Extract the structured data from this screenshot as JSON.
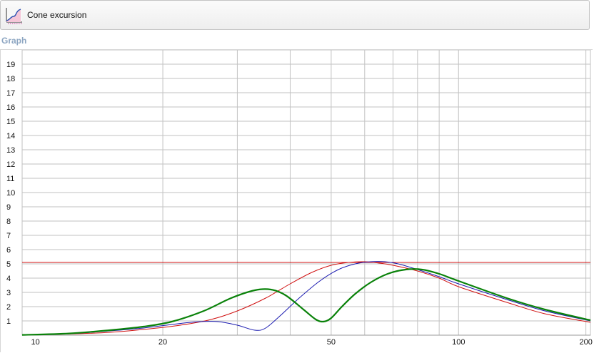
{
  "toolbar": {
    "button_label": "Cone excursion",
    "button_icon": "graph-icon"
  },
  "section": {
    "title": "Graph"
  },
  "colors": {
    "grid": "#c2c2c2",
    "axis_text": "#111111",
    "red": "#d01010",
    "blue": "#1a1ab0",
    "green": "#0a820a",
    "limit": "#d01010"
  },
  "chart_data": {
    "type": "line",
    "x_scale": "log",
    "xlim": [
      9.3,
      205
    ],
    "ylim": [
      0,
      20
    ],
    "x_ticks": [
      10,
      20,
      50,
      100,
      200
    ],
    "x_tick_labels": [
      "10",
      "20",
      "50",
      "100",
      "200"
    ],
    "x_gridlines": [
      20,
      30,
      40,
      50,
      60,
      70,
      80,
      90,
      100,
      200
    ],
    "y_ticks": [
      1,
      2,
      3,
      4,
      5,
      6,
      7,
      8,
      9,
      10,
      11,
      12,
      13,
      14,
      15,
      16,
      17,
      18,
      19
    ],
    "y_tick_labels": [
      "1",
      "2",
      "3",
      "4",
      "5",
      "6",
      "7",
      "8",
      "9",
      "10",
      "11",
      "12",
      "13",
      "14",
      "15",
      "16",
      "17",
      "18",
      "19"
    ],
    "grid": true,
    "limit_line": {
      "y": 5.1,
      "color": "red"
    },
    "series": [
      {
        "color": "red",
        "x": [
          9.3,
          12,
          15,
          18,
          22,
          26,
          30,
          35,
          40,
          45,
          50,
          55,
          60,
          65,
          70,
          80,
          90,
          100,
          130,
          160,
          205
        ],
        "y": [
          0.02,
          0.08,
          0.2,
          0.4,
          0.7,
          1.1,
          1.7,
          2.6,
          3.6,
          4.4,
          4.9,
          5.1,
          5.15,
          5.05,
          4.9,
          4.5,
          4.0,
          3.4,
          2.3,
          1.5,
          0.9
        ]
      },
      {
        "color": "blue",
        "x": [
          9.3,
          12,
          15,
          18,
          21,
          24,
          27,
          30,
          33,
          35,
          38,
          42,
          47,
          52,
          57,
          62,
          67,
          72,
          80,
          90,
          100,
          130,
          160,
          205
        ],
        "y": [
          0.02,
          0.1,
          0.3,
          0.5,
          0.75,
          0.93,
          0.95,
          0.7,
          0.35,
          0.5,
          1.4,
          2.6,
          3.8,
          4.6,
          5.0,
          5.15,
          5.15,
          5.0,
          4.6,
          4.1,
          3.6,
          2.5,
          1.7,
          1.0
        ]
      },
      {
        "color": "green",
        "x": [
          9.3,
          12,
          15,
          18,
          21,
          25,
          29,
          33,
          36,
          39,
          43,
          46,
          48,
          50,
          53,
          57,
          62,
          68,
          75,
          82,
          90,
          100,
          130,
          160,
          205
        ],
        "y": [
          0.02,
          0.12,
          0.35,
          0.6,
          0.95,
          1.7,
          2.6,
          3.15,
          3.2,
          2.8,
          1.8,
          1.1,
          0.95,
          1.2,
          2.0,
          2.9,
          3.7,
          4.3,
          4.6,
          4.6,
          4.3,
          3.8,
          2.6,
          1.8,
          1.05
        ]
      }
    ]
  }
}
